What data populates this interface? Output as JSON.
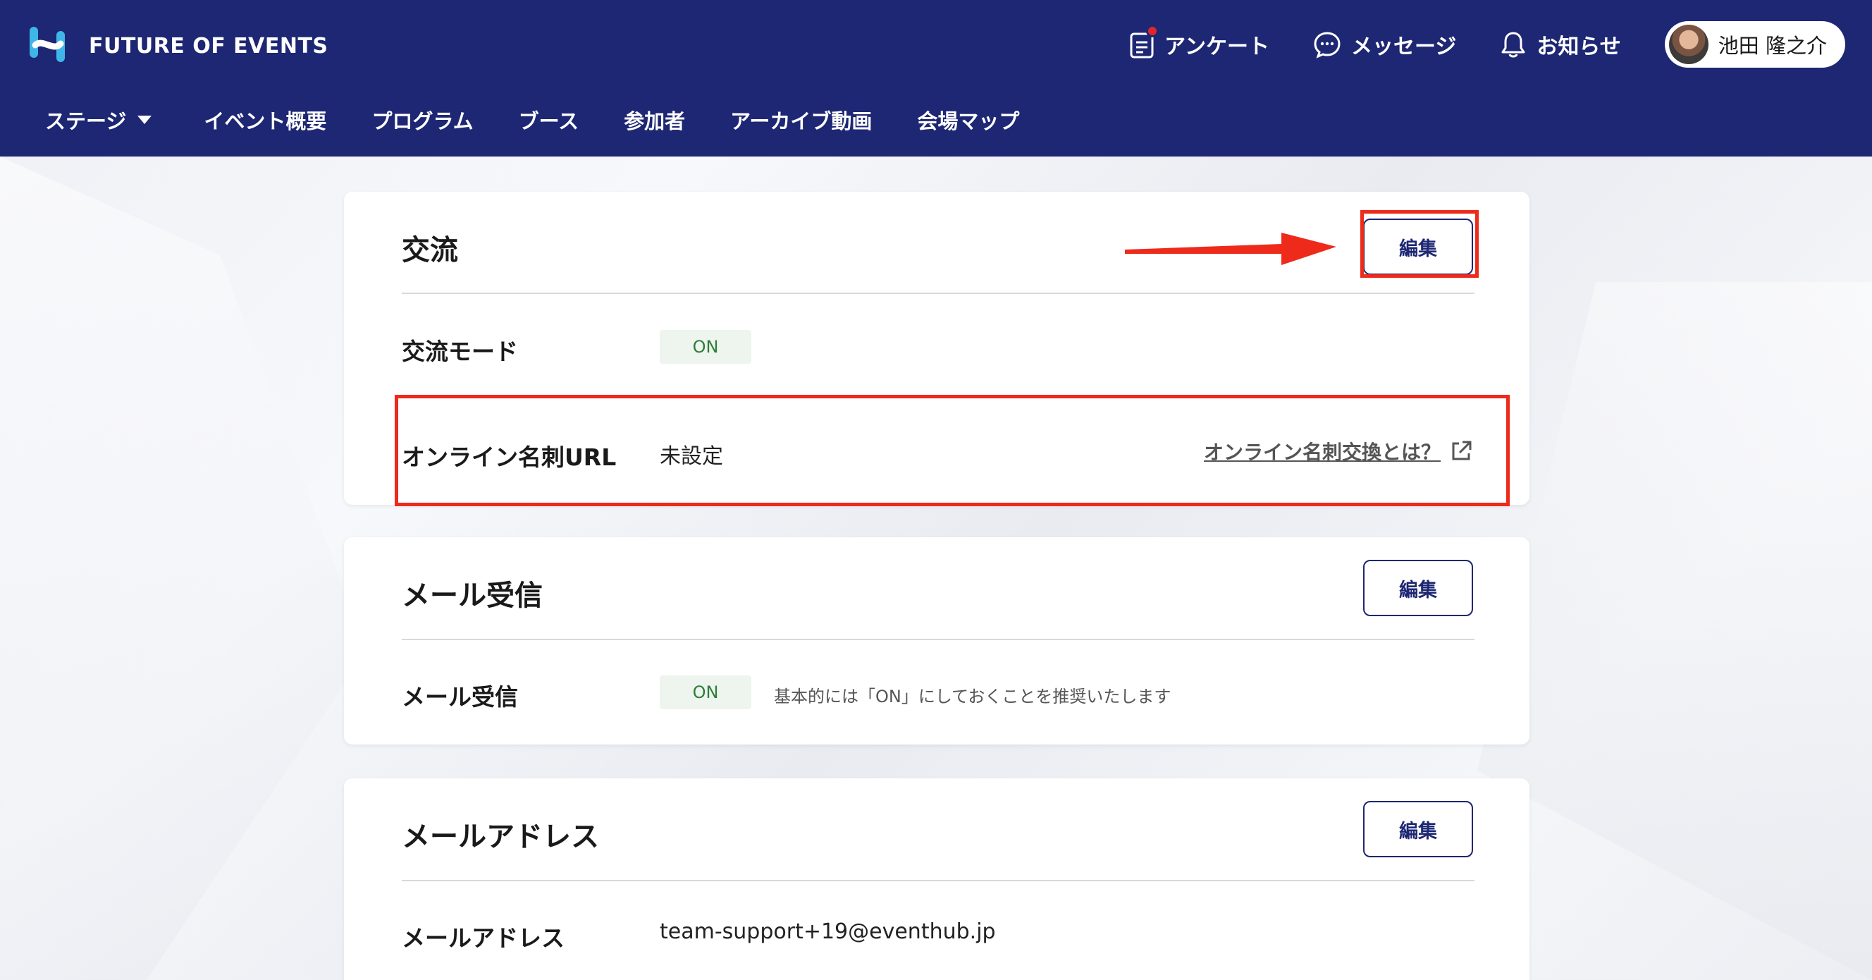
{
  "brand": {
    "name": "FUTURE OF EVENTS"
  },
  "header": {
    "actions": [
      {
        "label": "アンケート",
        "icon": "clipboard-icon"
      },
      {
        "label": "メッセージ",
        "icon": "chat-bubble-icon"
      },
      {
        "label": "お知らせ",
        "icon": "bell-icon"
      }
    ],
    "user": {
      "name": "池田 隆之介"
    }
  },
  "nav": {
    "items": [
      "ステージ",
      "イベント概要",
      "プログラム",
      "ブース",
      "参加者",
      "アーカイブ動画",
      "会場マップ"
    ]
  },
  "sections": {
    "exchange": {
      "title": "交流",
      "edit_label": "編集",
      "mode_label": "交流モード",
      "mode_value": "ON",
      "card_url_label": "オンライン名刺URL",
      "card_url_value": "未設定",
      "help_link": "オンライン名刺交換とは？"
    },
    "mail_receive": {
      "title": "メール受信",
      "edit_label": "編集",
      "row_label": "メール受信",
      "row_value": "ON",
      "hint": "基本的には「ON」にしておくことを推奨いたします"
    },
    "mail_address": {
      "title": "メールアドレス",
      "edit_label": "編集",
      "row_label": "メールアドレス",
      "row_value": "team-support+19@eventhub.jp"
    }
  },
  "colors": {
    "header_bg": "#1d2773",
    "annotation": "#ee2a1b",
    "on_badge_text": "#2e7d3a",
    "on_badge_bg": "#eef4ee"
  }
}
